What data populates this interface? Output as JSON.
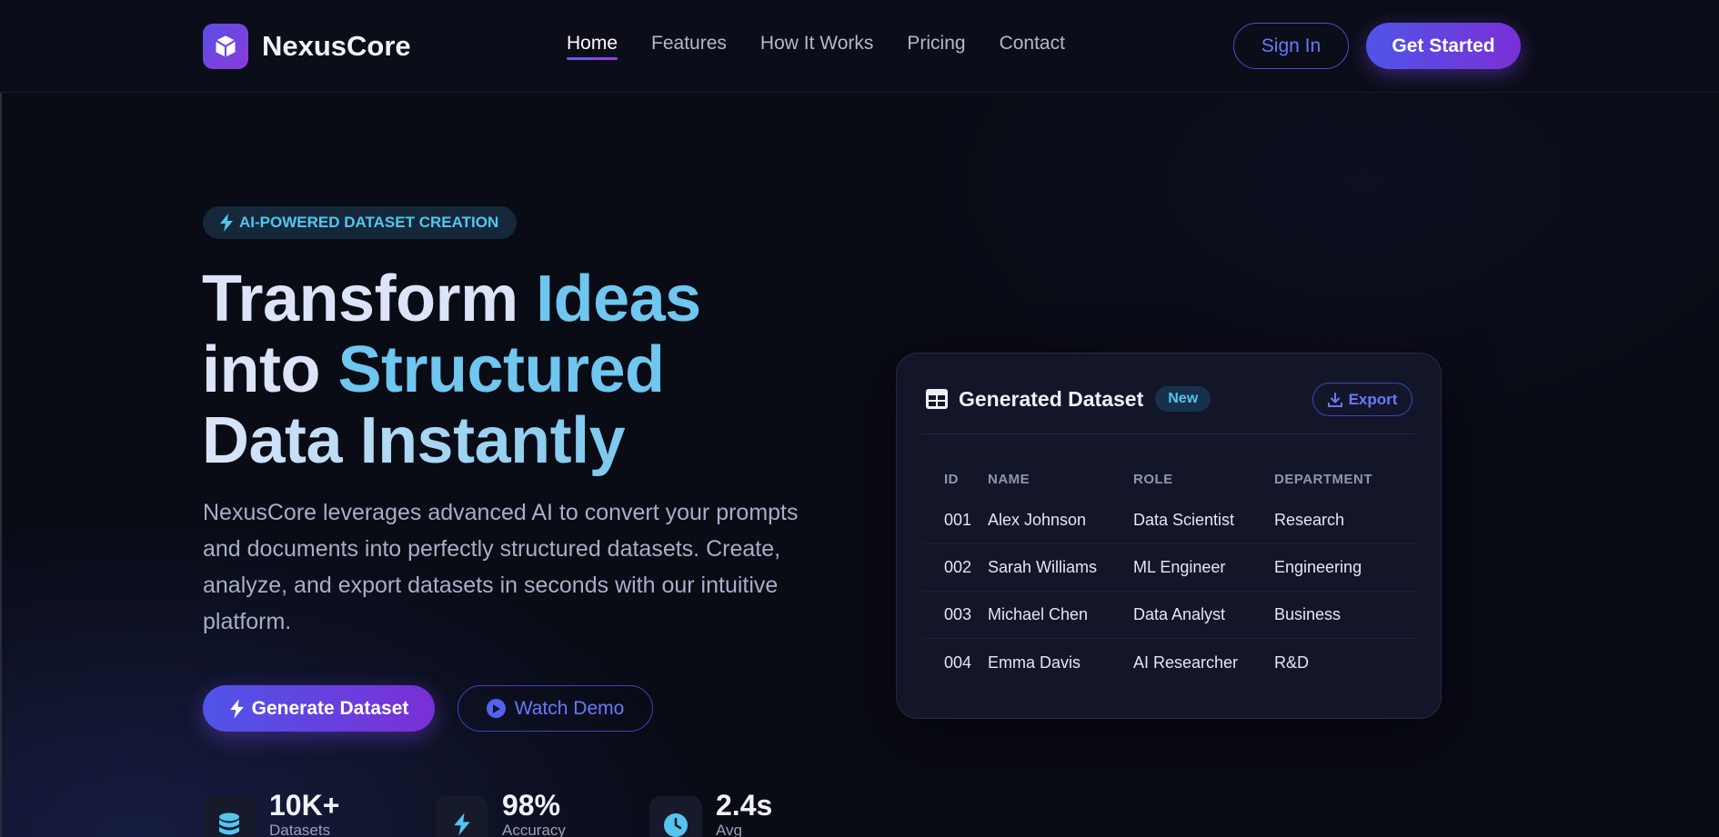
{
  "nav": {
    "brand": "NexusCore",
    "links": [
      {
        "label": "Home",
        "active": true
      },
      {
        "label": "Features",
        "active": false
      },
      {
        "label": "How It Works",
        "active": false
      },
      {
        "label": "Pricing",
        "active": false
      },
      {
        "label": "Contact",
        "active": false
      }
    ],
    "sign_in": "Sign In",
    "get_started": "Get Started"
  },
  "hero": {
    "badge": "AI-POWERED DATASET CREATION",
    "headline": {
      "line1_a": "Transform ",
      "line1_b": "Ideas",
      "line2_a": "into ",
      "line2_b": "Structured",
      "line3": "Data Instantly"
    },
    "description": "NexusCore leverages advanced AI to convert your prompts and documents into perfectly structured datasets. Create, analyze, and export datasets in seconds with our intuitive platform.",
    "primary_cta": "Generate Dataset",
    "secondary_cta": "Watch Demo"
  },
  "stats": [
    {
      "icon": "database-icon",
      "value": "10K+",
      "label": "Datasets"
    },
    {
      "icon": "lightning-icon",
      "value": "98%",
      "label": "Accuracy"
    },
    {
      "icon": "clock-icon",
      "value": "2.4s",
      "label": "Avg"
    }
  ],
  "card": {
    "title": "Generated Dataset",
    "badge": "New",
    "export": "Export",
    "columns": [
      "ID",
      "NAME",
      "ROLE",
      "DEPARTMENT"
    ],
    "rows": [
      [
        "001",
        "Alex Johnson",
        "Data Scientist",
        "Research"
      ],
      [
        "002",
        "Sarah Williams",
        "ML Engineer",
        "Engineering"
      ],
      [
        "003",
        "Michael Chen",
        "Data Analyst",
        "Business"
      ],
      [
        "004",
        "Emma Davis",
        "AI Researcher",
        "R&D"
      ]
    ]
  },
  "colors": {
    "accent": "#5b5fef",
    "accent_purple": "#7a2fd6",
    "cyan": "#6fc6ee",
    "background": "#090b15"
  }
}
